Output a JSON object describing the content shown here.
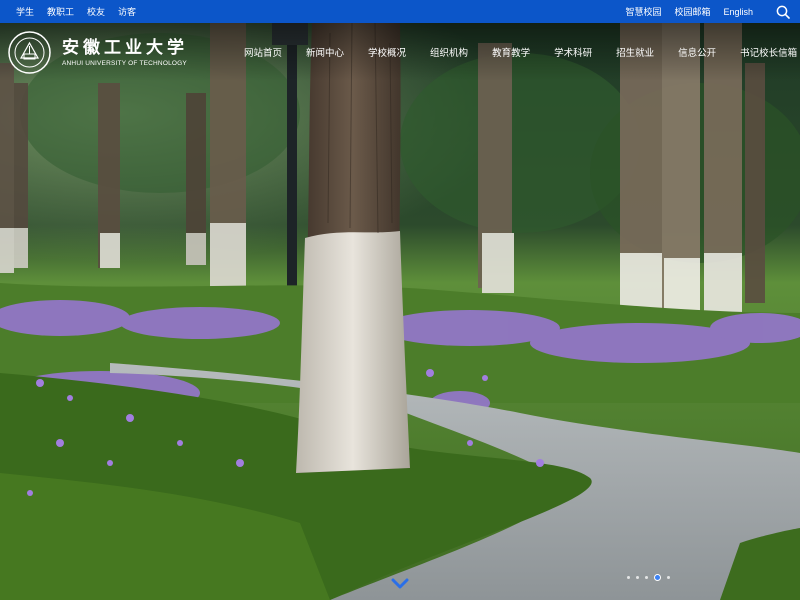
{
  "topbar": {
    "links_left": [
      "学生",
      "教职工",
      "校友",
      "访客"
    ],
    "links_right": [
      "智慧校园",
      "校园邮箱",
      "English"
    ],
    "search_icon": "search-icon",
    "bg_color": "#0c56c9"
  },
  "logo": {
    "name_cn": "安徽工业大学",
    "name_en": "ANHUI UNIVERSITY OF TECHNOLOGY",
    "seal_icon": "university-seal-icon"
  },
  "nav": {
    "items": [
      "网站首页",
      "新闻中心",
      "学校概况",
      "组织机构",
      "教育教学",
      "学术科研",
      "招生就业",
      "信息公开",
      "书记校长信箱"
    ]
  },
  "hero": {
    "scroll_icon": "chevron-down-icon",
    "accent_color": "#2a6fe8",
    "slides": 5,
    "active_slide": 4
  }
}
